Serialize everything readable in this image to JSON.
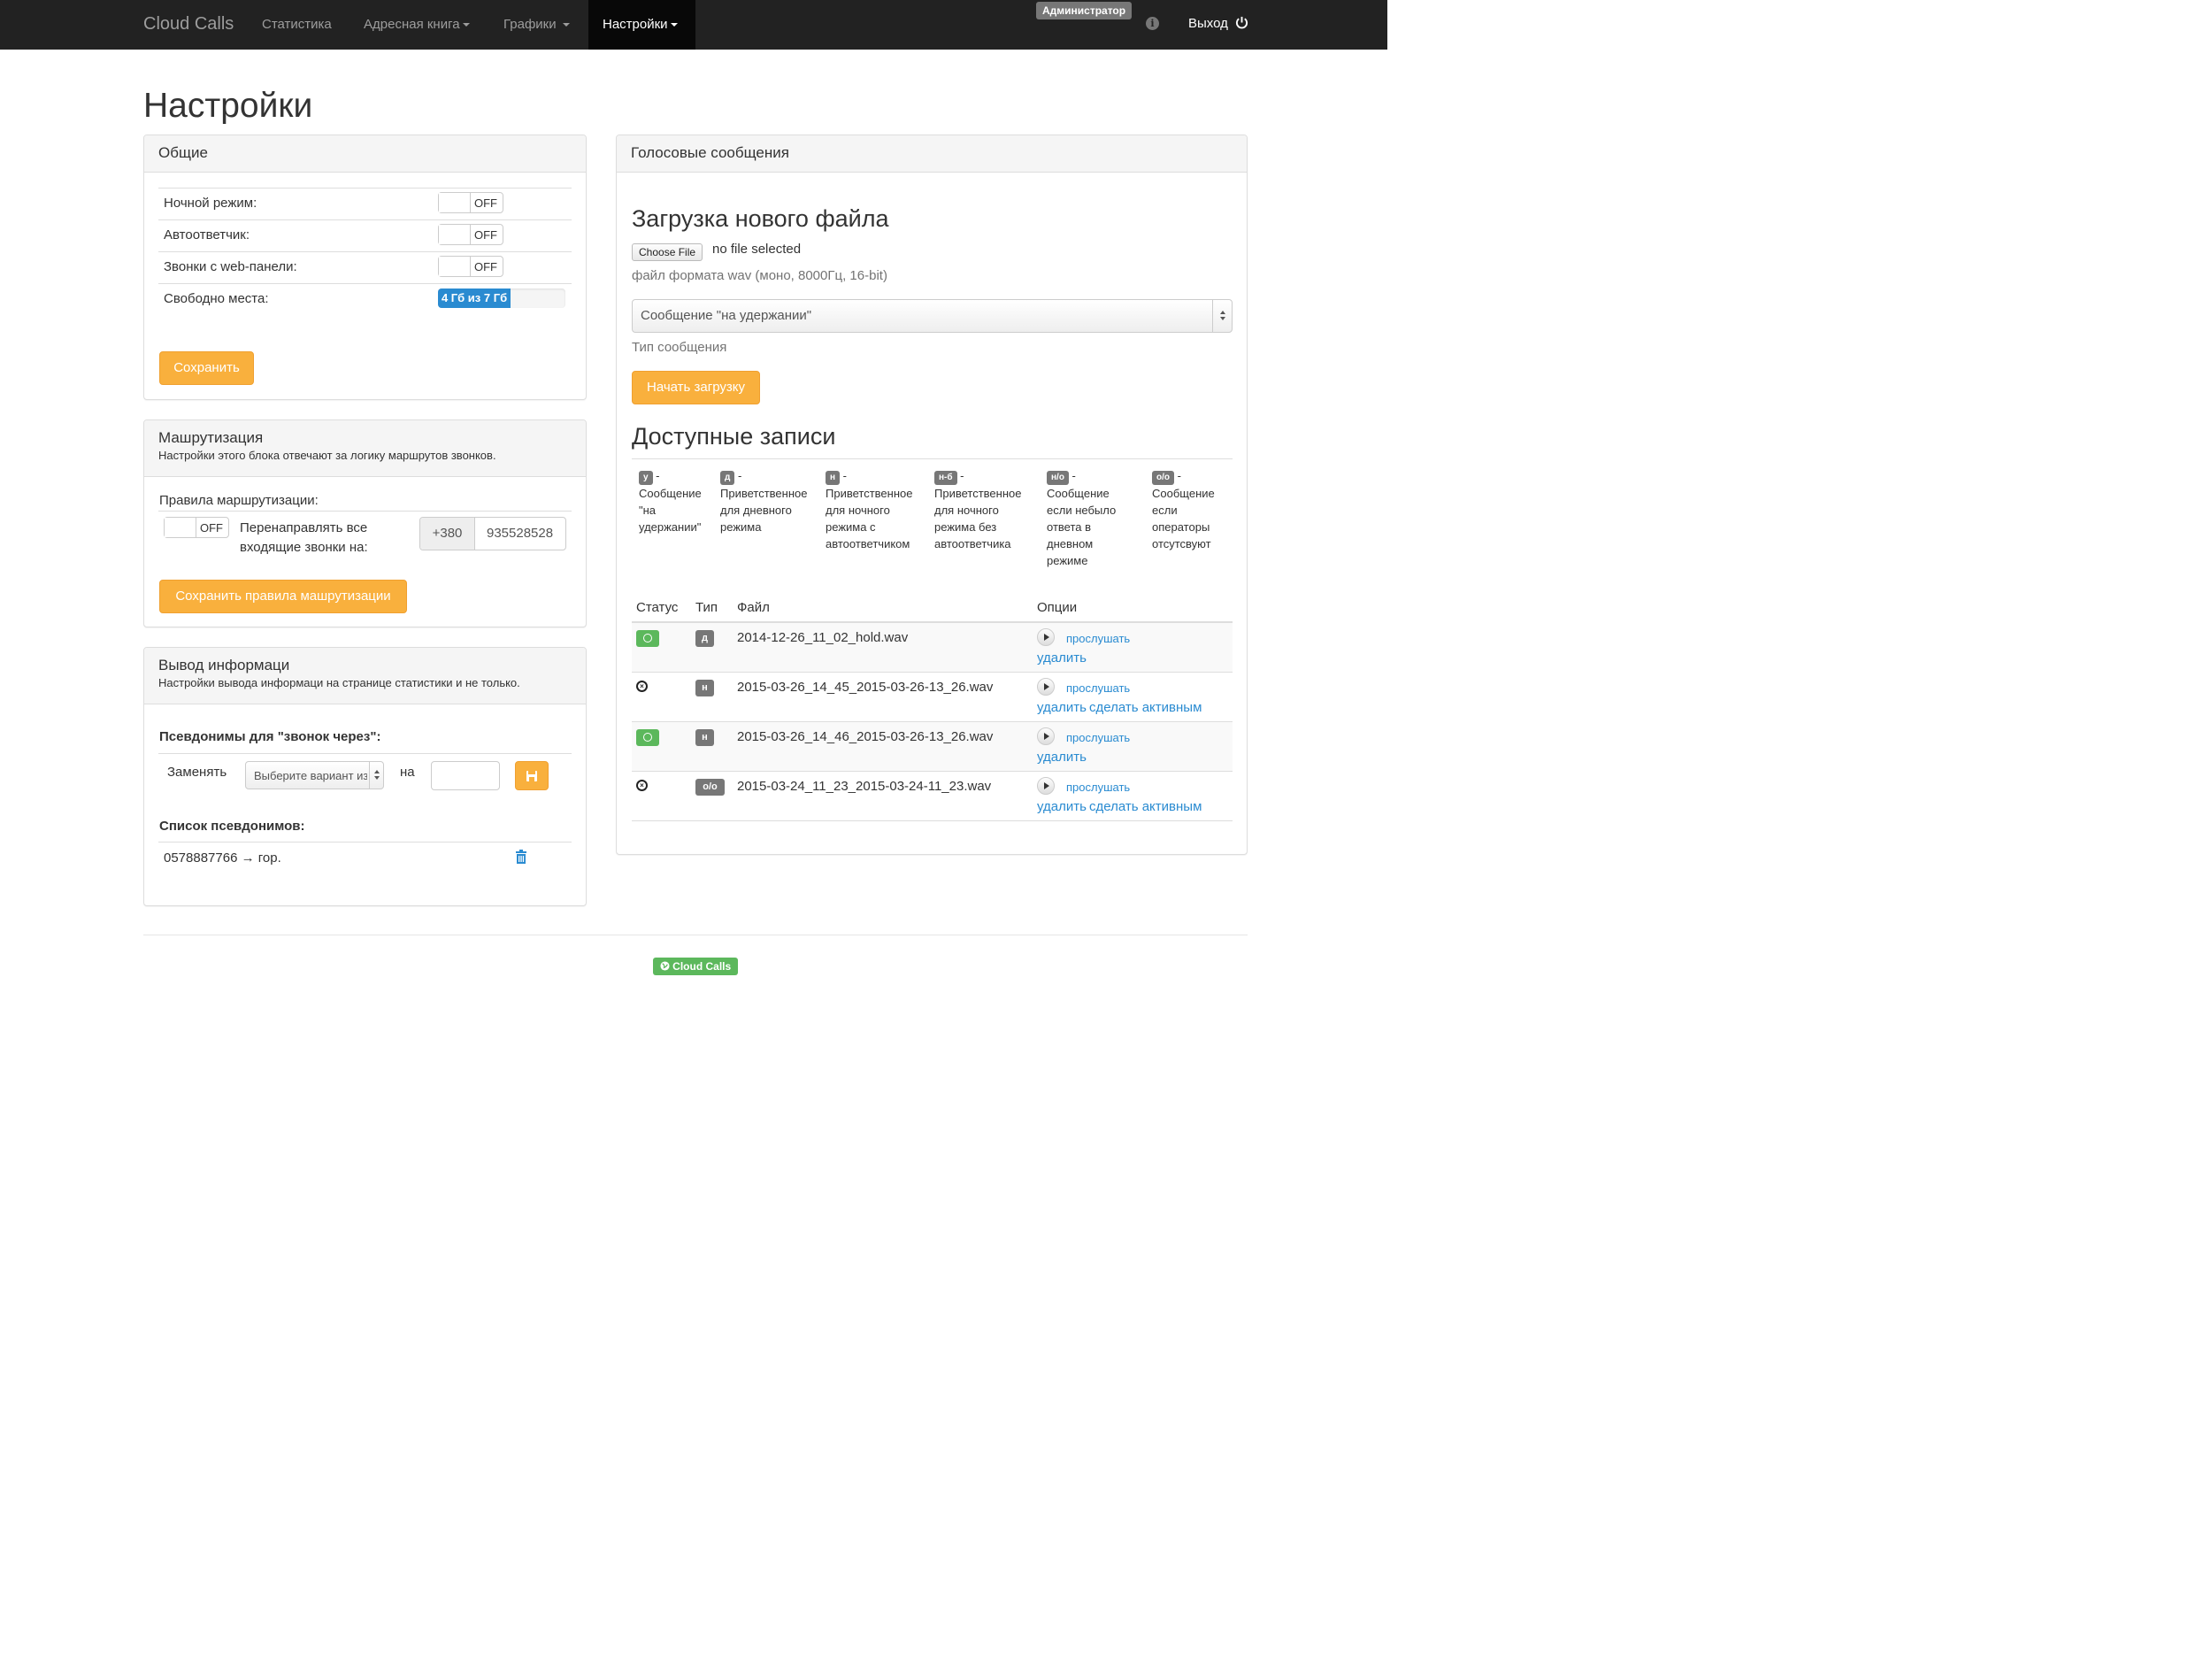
{
  "navbar": {
    "brand": "Cloud Calls",
    "items": [
      {
        "label": "Статистика"
      },
      {
        "label": "Адресная книга"
      },
      {
        "label": "Графики"
      },
      {
        "label": "Настройки"
      }
    ],
    "admin_badge": "Администратор",
    "logout": "Выход"
  },
  "page_title": "Настройки",
  "general": {
    "title": "Общие",
    "rows": [
      {
        "label": "Ночной режим:",
        "state": "OFF"
      },
      {
        "label": "Автоответчик:",
        "state": "OFF"
      },
      {
        "label": "Звонки с web-панели:",
        "state": "OFF"
      }
    ],
    "free_space_label": "Свободно места:",
    "free_space_text": "4 Гб из 7 Гб",
    "free_space_fraction": 0.57,
    "save_button": "Сохранить"
  },
  "routing": {
    "title": "Машрутизация",
    "subtitle": "Настройки этого блока отвечают за логику маршрутов звонков.",
    "rules_label": "Правила маршрутизации:",
    "forward_state": "OFF",
    "forward_label_line1": "Перенаправлять все",
    "forward_label_line2": "входящие звонки на:",
    "country_code": "+380",
    "phone_value": "935528528",
    "save_button": "Сохранить правила машрутизации"
  },
  "output": {
    "title": "Вывод информаци",
    "subtitle": "Настройки вывода информаци на странице статистики и не только.",
    "aliases_label": "Псевдонимы для \"звонок через\":",
    "replace_label": "Заменять",
    "select_placeholder": "Выберите вариант из",
    "on_label": "на",
    "alias_input_value": "",
    "alias_list_label": "Список псевдонимов:",
    "aliases": [
      {
        "text": "0578887766 → гор."
      }
    ]
  },
  "voice": {
    "title": "Голосовые сообщения",
    "upload_heading": "Загрузка нового файла",
    "choose_file": "Choose File",
    "no_file": "no file selected",
    "file_hint": "файл формата wav (моно, 8000Гц, 16-bit)",
    "message_type_selected": "Сообщение \"на удержании\"",
    "message_type_help": "Тип сообщения",
    "start_upload": "Начать загрузку",
    "records_heading": "Доступные записи",
    "legend": [
      {
        "badge": "у",
        "text_lines": [
          "Сообщение",
          "\"на",
          "удержании\""
        ]
      },
      {
        "badge": "д",
        "text_lines": [
          "Приветственное",
          "для дневного",
          "режима"
        ]
      },
      {
        "badge": "н",
        "text_lines": [
          "Приветственное",
          "для ночного",
          "режима с",
          "автоответчиком"
        ]
      },
      {
        "badge": "н-б",
        "text_lines": [
          "Приветственное",
          "для ночного",
          "режима без",
          "автоответчика"
        ]
      },
      {
        "badge": "н/о",
        "text_lines": [
          "Сообщение",
          "если небыло",
          "ответа в",
          "дневном",
          "режиме"
        ]
      },
      {
        "badge": "о/о",
        "text_lines": [
          "Сообщение",
          "если",
          "операторы",
          "отсутсвуют"
        ]
      }
    ],
    "table_headers": {
      "status": "Статус",
      "type": "Тип",
      "file": "Файл",
      "options": "Опции"
    },
    "rows": [
      {
        "status": "active",
        "type": "д",
        "file": "2014-12-26_11_02_hold.wav",
        "listen": "прослушать",
        "delete": "удалить",
        "activate": ""
      },
      {
        "status": "inactive",
        "type": "н",
        "file": "2015-03-26_14_45_2015-03-26-13_26.wav",
        "listen": "прослушать",
        "delete": "удалить",
        "activate": "сделать активным"
      },
      {
        "status": "active",
        "type": "н",
        "file": "2015-03-26_14_46_2015-03-26-13_26.wav",
        "listen": "прослушать",
        "delete": "удалить",
        "activate": ""
      },
      {
        "status": "inactive",
        "type": "о/о",
        "file": "2015-03-24_11_23_2015-03-24-11_23.wav",
        "listen": "прослушать",
        "delete": "удалить",
        "activate": "сделать активным"
      }
    ]
  },
  "footer": {
    "badge": "Cloud Calls"
  },
  "colors": {
    "accent_orange": "#f9b03d",
    "link_blue": "#2a8bd1",
    "success_green": "#5cb85c",
    "navbar": "#222222"
  }
}
